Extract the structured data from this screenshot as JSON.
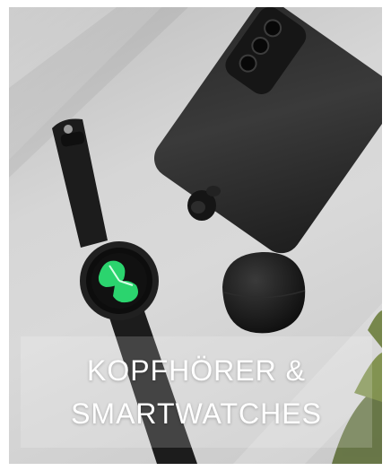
{
  "tile": {
    "caption_line_1": "KOPFHÖRER &",
    "caption_line_2": "SMARTWATCHES"
  },
  "icons": {
    "phone": "smartphone-icon",
    "watch": "smartwatch-icon",
    "earbud": "earbud-icon",
    "case": "earbuds-case-icon"
  },
  "colors": {
    "watch_face_accent": "#2bd46e",
    "device_black": "#1e1e1e",
    "caption_text": "#ffffff"
  }
}
